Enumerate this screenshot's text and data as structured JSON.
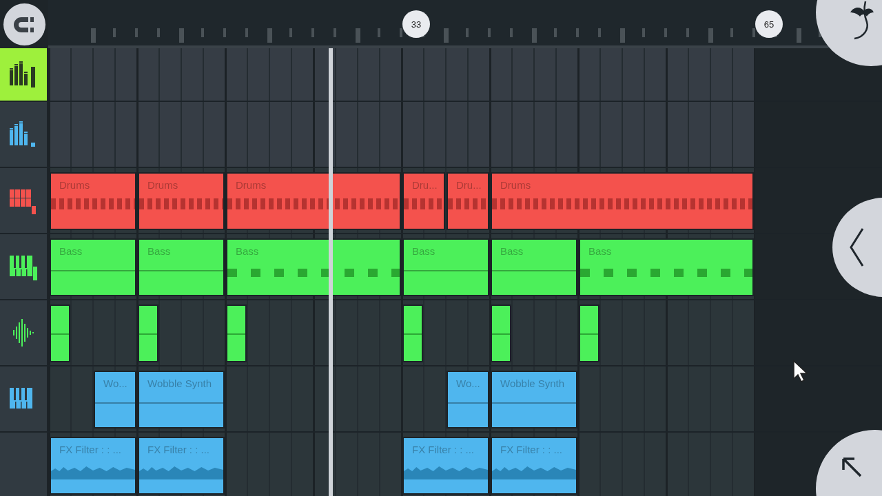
{
  "ruler": {
    "markers": [
      {
        "label": "33",
        "kind": "a"
      },
      {
        "label": "65",
        "kind": "b"
      }
    ]
  },
  "playlist": {
    "tracks": [
      {
        "color": "#9ef03c",
        "selected": true
      },
      {
        "color": "#4fb6ee",
        "selected": false
      },
      {
        "color": "#f4524d",
        "selected": false,
        "clips": [
          {
            "label": "Drums",
            "kind": "drums"
          },
          {
            "label": "Drums",
            "kind": "drums"
          },
          {
            "label": "Drums",
            "kind": "drums"
          },
          {
            "label": "Dru...",
            "kind": "drums"
          },
          {
            "label": "Dru...",
            "kind": "drums"
          },
          {
            "label": "Drums",
            "kind": "drums"
          }
        ]
      },
      {
        "color": "#4cf05a",
        "selected": false,
        "clips": [
          {
            "label": "Bass",
            "kind": "notes"
          },
          {
            "label": "Bass",
            "kind": "notes"
          },
          {
            "label": "Bass",
            "kind": "melody"
          },
          {
            "label": "Bass",
            "kind": "notes"
          },
          {
            "label": "Bass",
            "kind": "notes"
          },
          {
            "label": "Bass",
            "kind": "melody"
          }
        ]
      },
      {
        "color": "#4cf05a",
        "selected": false,
        "clips": [
          {
            "kind": "audio"
          },
          {
            "kind": "audio"
          },
          {
            "kind": "audio"
          },
          {
            "kind": "audio"
          },
          {
            "kind": "audio"
          },
          {
            "kind": "audio"
          }
        ]
      },
      {
        "color": "#4fb6ee",
        "selected": false,
        "clips": [
          {
            "label": "Wo...",
            "kind": "notes"
          },
          {
            "label": "Wobble Synth",
            "kind": "notes"
          },
          {
            "label": "Wo...",
            "kind": "notes"
          },
          {
            "label": "Wobble Synth",
            "kind": "notes"
          }
        ]
      },
      {
        "color": "#4fb6ee",
        "selected": false,
        "clips": [
          {
            "label": "FX Filter :  : ...",
            "kind": "automation"
          },
          {
            "label": "FX Filter :  : ...",
            "kind": "automation"
          },
          {
            "label": "FX Filter :  : ...",
            "kind": "automation"
          },
          {
            "label": "FX Filter :  : ...",
            "kind": "automation"
          }
        ]
      }
    ]
  }
}
